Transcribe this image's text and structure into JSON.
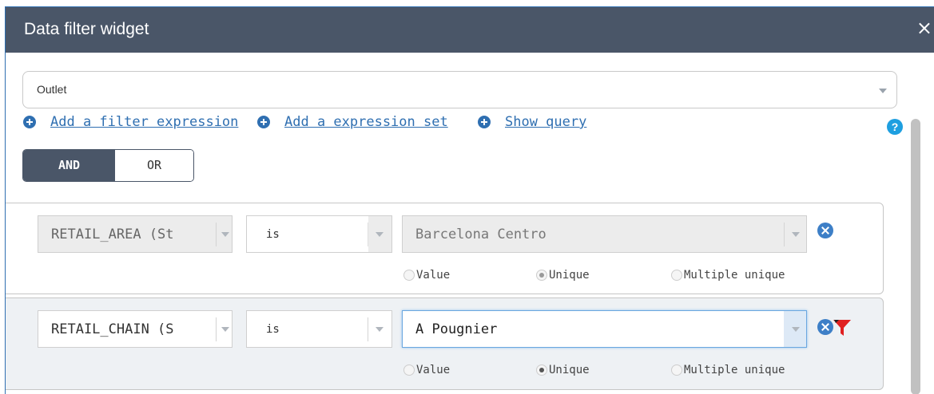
{
  "window": {
    "title": "Data filter widget",
    "close_glyph": "×"
  },
  "layer_select": {
    "value": "Outlet"
  },
  "actions": [
    {
      "label": "Add a filter expression",
      "icon": "plus-circle-icon"
    },
    {
      "label": "Add a expression set",
      "icon": "plus-circle-icon"
    },
    {
      "label": "Show query",
      "icon": "plus-circle-icon"
    }
  ],
  "help": {
    "glyph": "?"
  },
  "logic_toggle": {
    "and_label": "AND",
    "or_label": "OR",
    "selected": "AND"
  },
  "expressions": [
    {
      "field": "RETAIL_AREA (St",
      "operator": "is",
      "value": "Barcelona Centro",
      "disabled": true,
      "radios": {
        "value": "Value",
        "unique": "Unique",
        "multiple": "Multiple unique",
        "selected": "Unique"
      }
    },
    {
      "field": "RETAIL_CHAIN (S",
      "operator": "is",
      "value": "A Pougnier",
      "disabled": false,
      "radios": {
        "value": "Value",
        "unique": "Unique",
        "multiple": "Multiple unique",
        "selected": "Unique"
      }
    }
  ],
  "colors": {
    "titlebar": "#4a5668",
    "link": "#2f6fb1",
    "help": "#1e9fe0",
    "filter_icon": "#e02020"
  }
}
